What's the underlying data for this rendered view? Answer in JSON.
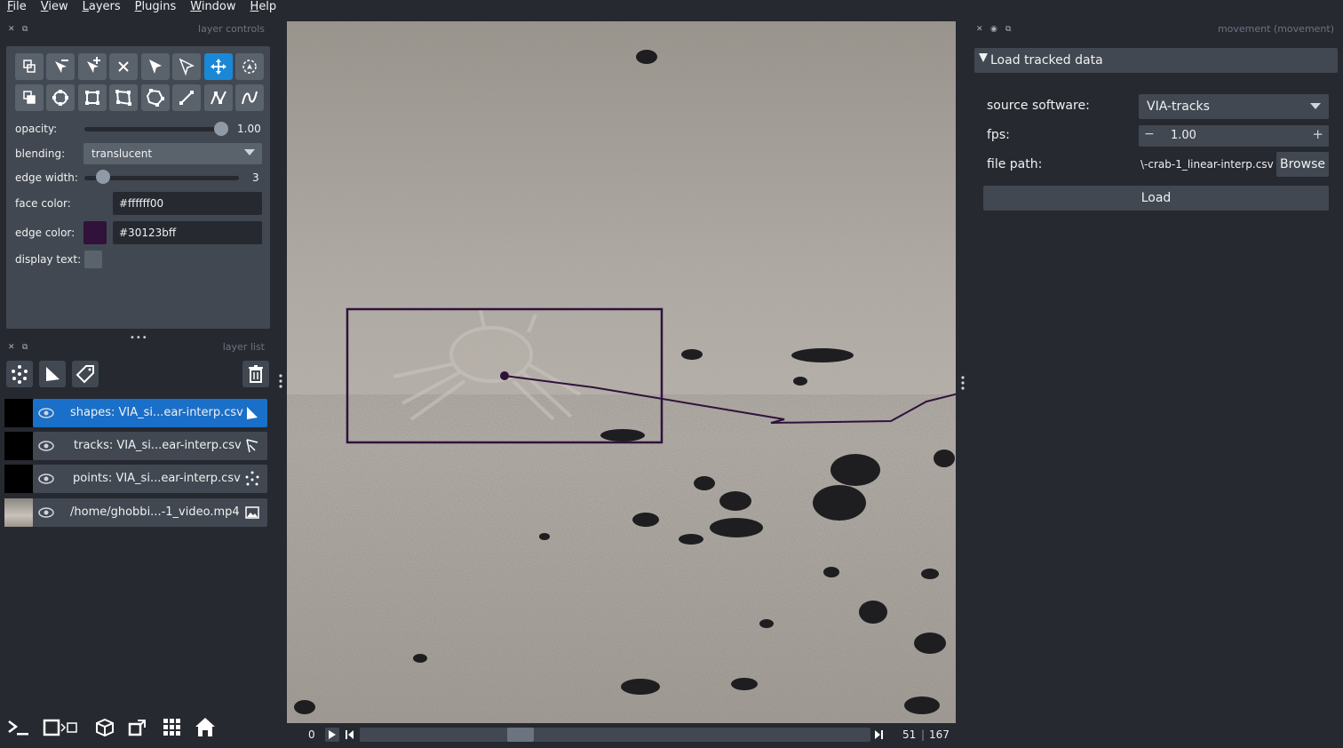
{
  "menu": [
    "File",
    "View",
    "Layers",
    "Plugins",
    "Window",
    "Help"
  ],
  "left_dock": {
    "controls_title": "layer controls",
    "list_title": "layer list",
    "opacity_label": "opacity:",
    "opacity_value": "1.00",
    "opacity_level": 1.0,
    "blending_label": "blending:",
    "blending_value": "translucent",
    "edge_width_label": "edge width:",
    "edge_width_value": "3",
    "face_color_label": "face color:",
    "face_color_value": "#ffffff00",
    "edge_color_label": "edge color:",
    "edge_color_value": "#30123bff",
    "edge_color_swatch": "#30123b",
    "display_text_label": "display text:"
  },
  "layers": [
    {
      "name": "shapes: VIA_si...ear-interp.csv",
      "type_icon": "shapes-icon",
      "selected": true
    },
    {
      "name": "tracks: VIA_si...ear-interp.csv",
      "type_icon": "tracks-icon",
      "selected": false
    },
    {
      "name": "points: VIA_si...ear-interp.csv",
      "type_icon": "points-icon",
      "selected": false
    },
    {
      "name": "/home/ghobbi...-1_video.mp4",
      "type_icon": "image-icon",
      "selected": false
    }
  ],
  "dims": {
    "start": "0",
    "current": "51",
    "total": "167"
  },
  "plugin": {
    "dock_title": "movement (movement)",
    "section_title": "Load tracked data",
    "source_label": "source software:",
    "source_value": "VIA-tracks",
    "fps_label": "fps:",
    "fps_value": "1.00",
    "file_path_label": "file path:",
    "file_path_value": "\\-crab-1_linear-interp.csv",
    "browse_label": "Browse",
    "load_label": "Load"
  },
  "colors": {
    "accent": "#1a88d6",
    "selected_layer": "#1a6fc9",
    "track_line": "#30123b"
  }
}
